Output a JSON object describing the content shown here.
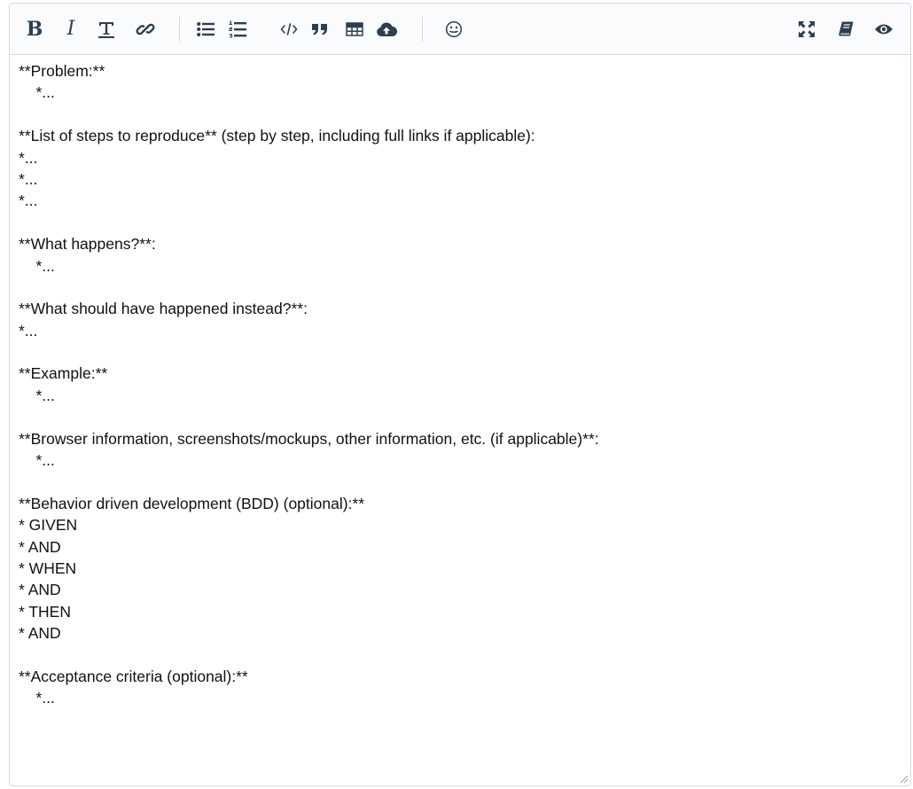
{
  "toolbar": {
    "left_buttons": [
      {
        "name": "bold-button",
        "icon": "bold-icon",
        "glyph": "B",
        "tooltip": "Bold"
      },
      {
        "name": "italic-button",
        "icon": "italic-icon",
        "glyph": "I",
        "tooltip": "Italic"
      },
      {
        "name": "heading-button",
        "icon": "heading-icon",
        "tooltip": "Heading"
      },
      {
        "name": "link-button",
        "icon": "link-icon",
        "tooltip": "Link"
      },
      {
        "name": "unordered-list-button",
        "icon": "unordered-list-icon",
        "tooltip": "Unordered list"
      },
      {
        "name": "ordered-list-button",
        "icon": "ordered-list-icon",
        "tooltip": "Ordered list"
      },
      {
        "name": "code-button",
        "icon": "code-icon",
        "tooltip": "Code"
      },
      {
        "name": "quote-button",
        "icon": "quote-icon",
        "tooltip": "Quote"
      },
      {
        "name": "table-button",
        "icon": "table-icon",
        "tooltip": "Table"
      },
      {
        "name": "upload-button",
        "icon": "cloud-upload-icon",
        "tooltip": "Upload"
      },
      {
        "name": "emoji-button",
        "icon": "smiley-icon",
        "tooltip": "Emoji"
      }
    ],
    "right_buttons": [
      {
        "name": "fullscreen-button",
        "icon": "fullscreen-icon",
        "tooltip": "Fullscreen"
      },
      {
        "name": "guide-button",
        "icon": "book-icon",
        "tooltip": "Markdown guide"
      },
      {
        "name": "preview-button",
        "icon": "eye-icon",
        "tooltip": "Preview"
      }
    ],
    "colors": {
      "icon": "#2c3e50",
      "background": "#fafbfc",
      "border": "#d6dae0"
    }
  },
  "content": {
    "lines": [
      "**Problem:**",
      "    *...",
      "",
      "**List of steps to reproduce** (step by step, including full links if applicable):",
      "*...",
      "*...",
      "*...",
      "",
      "**What happens?**:",
      "    *...",
      "",
      "**What should have happened instead?**:",
      "*...",
      "",
      "**Example:**",
      "    *...",
      "",
      "**Browser information, screenshots/mockups, other information, etc. (if applicable)**:",
      "    *...",
      "",
      "**Behavior driven development (BDD) (optional):**",
      "* GIVEN",
      "* AND",
      "* WHEN",
      "* AND",
      "* THEN",
      "* AND",
      "",
      "**Acceptance criteria (optional):**",
      "    *..."
    ]
  }
}
